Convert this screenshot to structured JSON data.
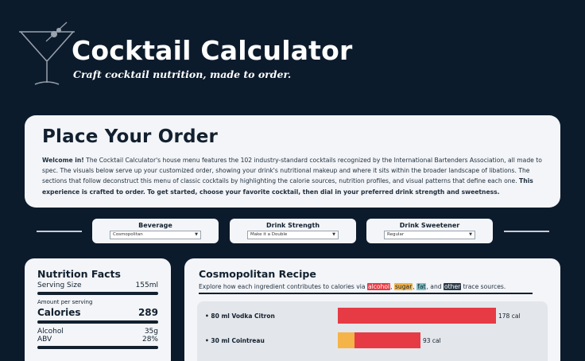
{
  "header": {
    "title": "Cocktail Calculator",
    "subtitle": "Craft cocktail nutrition, made to order."
  },
  "order": {
    "title": "Place Your Order",
    "intro_bold": "Welcome in!",
    "intro_text": " The Cocktail Calculator's house menu features the 102 industry-standard cocktails recognized by the International Bartenders Association, all made to spec. The visuals below serve up your customized order, showing your drink's nutritional makeup and where it sits within the broader landscape of libations. The sections that follow deconstruct this menu of classic cocktails by highlighting the calorie sources, nutrition profiles, and visual patterns that define each one. ",
    "outro_bold": "This experience is crafted to order. To get started, choose your favorite cocktail, then dial in your preferred drink strength and sweetness."
  },
  "filters": [
    {
      "label": "Beverage",
      "value": "Cosmopolitan"
    },
    {
      "label": "Drink Strength",
      "value": "Make it a Double"
    },
    {
      "label": "Drink Sweetener",
      "value": "Regular"
    }
  ],
  "nutrition": {
    "title": "Nutrition Facts",
    "serving_label": "Serving Size",
    "serving_value": "155ml",
    "amount_label": "Amount per serving",
    "calories_label": "Calories",
    "calories_value": "289",
    "alcohol_label": "Alcohol",
    "alcohol_value": "35g",
    "abv_label": "ABV",
    "abv_value": "28%"
  },
  "recipe": {
    "title": "Cosmopolitan Recipe",
    "desc_prefix": "Explore how each ingredient contributes to calories via ",
    "tag_alcohol": "alcohol",
    "tag_sugar": "sugar",
    "tag_fat": "fat",
    "and_text": "and",
    "tag_other": "other",
    "desc_suffix": " trace sources."
  },
  "colors": {
    "alcohol": "#e63b45",
    "sugar": "#f5b447",
    "fat": "#7cc4c9",
    "other": "#2a3a48"
  },
  "chart_data": {
    "type": "bar",
    "categories": [
      "80 ml Vodka Citron",
      "30 ml Cointreau"
    ],
    "series": [
      {
        "name": "alcohol",
        "values": [
          178,
          74
        ]
      },
      {
        "name": "sugar",
        "values": [
          0,
          19
        ]
      }
    ],
    "value_labels": [
      "178 cal",
      "93 cal"
    ],
    "xlim": [
      0,
      178
    ]
  }
}
